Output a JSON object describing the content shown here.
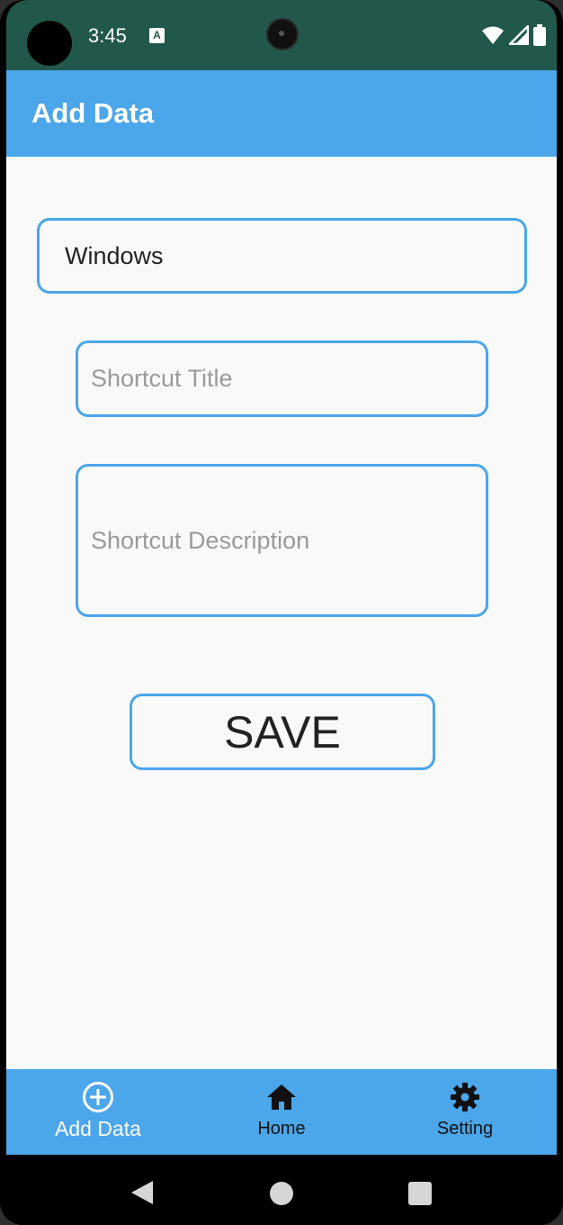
{
  "status_bar": {
    "time": "3:45",
    "notification_icon": "A"
  },
  "app_bar": {
    "title": "Add Data"
  },
  "form": {
    "os_field_value": "Windows",
    "title_placeholder": "Shortcut Title",
    "description_placeholder": "Shortcut Description",
    "save_label": "SAVE"
  },
  "bottom_nav": {
    "items": [
      {
        "label": "Add Data",
        "icon": "add-circle-icon",
        "active": true
      },
      {
        "label": "Home",
        "icon": "home-icon",
        "active": false
      },
      {
        "label": "Setting",
        "icon": "gear-icon",
        "active": false
      }
    ]
  },
  "colors": {
    "status_bar": "#21584b",
    "accent": "#4ba6ea",
    "background": "#f9f9f9"
  }
}
